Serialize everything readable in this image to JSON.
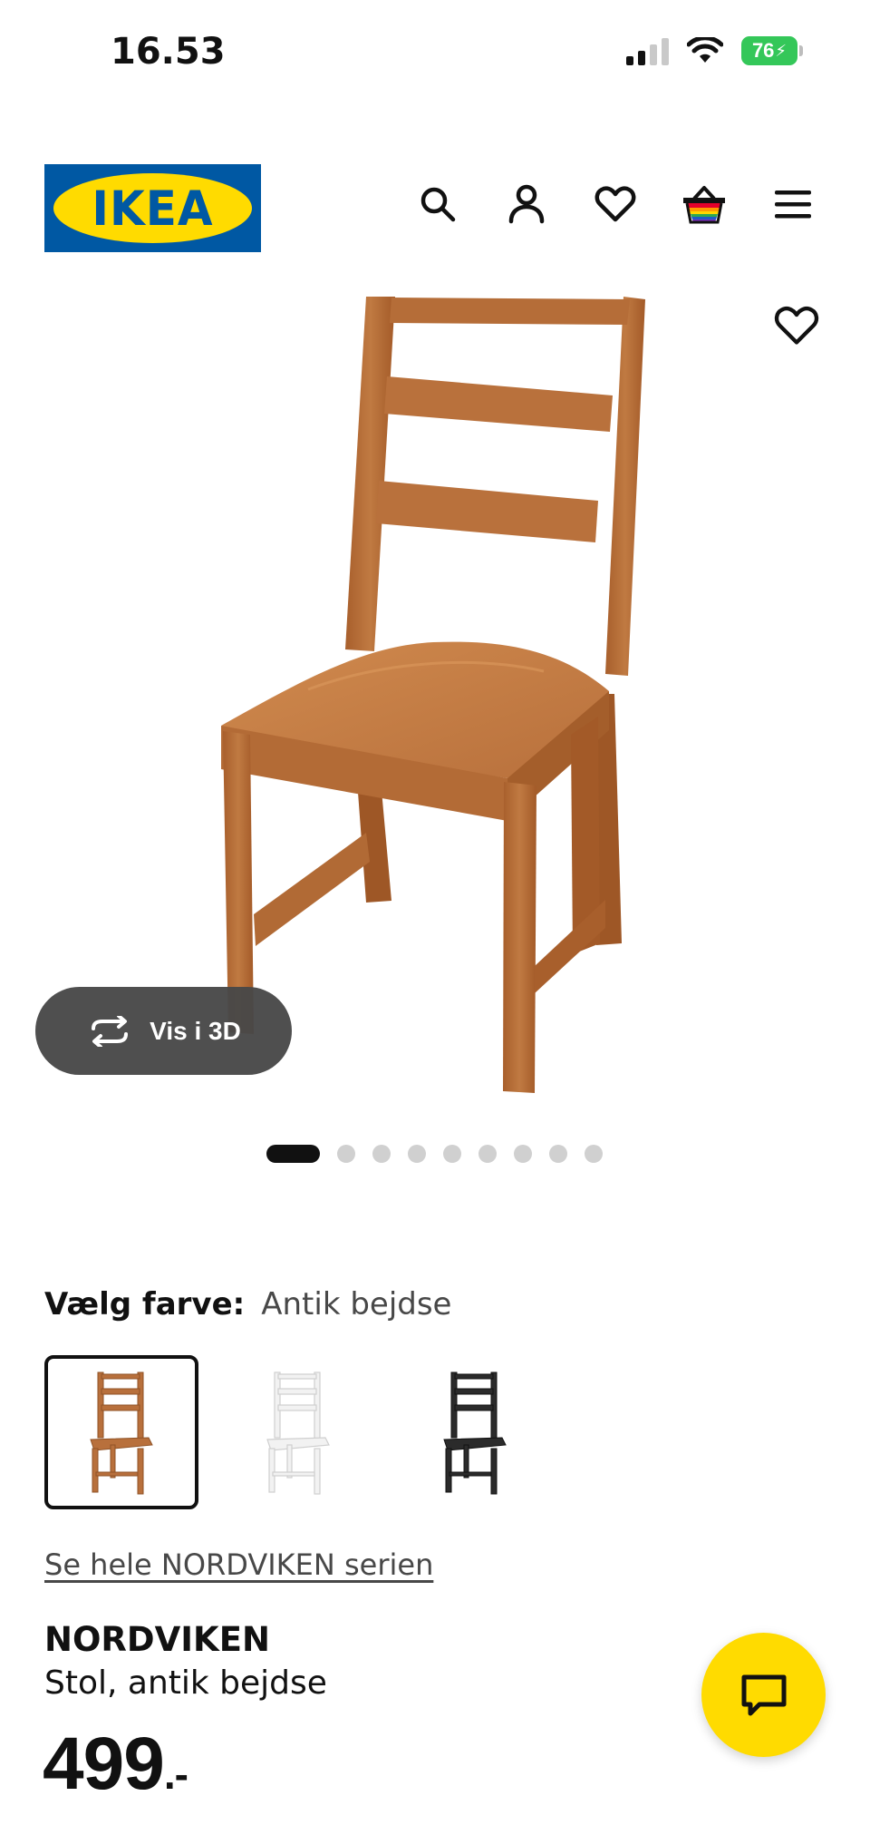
{
  "status_bar": {
    "time": "16.53",
    "battery_level": "76",
    "battery_color": "#34c759"
  },
  "header": {
    "logo_text": "IKEA",
    "brand_colors": {
      "blue": "#0058a3",
      "yellow": "#ffdb00"
    },
    "icons": [
      "search-icon",
      "account-icon",
      "heart-icon",
      "basket-icon",
      "menu-icon"
    ]
  },
  "gallery": {
    "view_3d_label": "Vis i 3D",
    "image_count": 9,
    "active_index": 0,
    "favorite_icon": "heart-icon"
  },
  "color_picker": {
    "label": "Vælg farve:",
    "selected": "Antik bejdse",
    "options": [
      {
        "name": "Antik bejdse",
        "color": "#b8703c"
      },
      {
        "name": "Hvid",
        "color": "#f2f2f2"
      },
      {
        "name": "Sort",
        "color": "#2b2b2b"
      }
    ]
  },
  "product": {
    "series_link": "Se hele NORDVIKEN serien",
    "name": "NORDVIKEN",
    "description": "Stol, antik bejdse",
    "price": "499",
    "price_suffix": ".-"
  },
  "chat": {
    "icon": "chat-icon",
    "color": "#ffdb00"
  }
}
